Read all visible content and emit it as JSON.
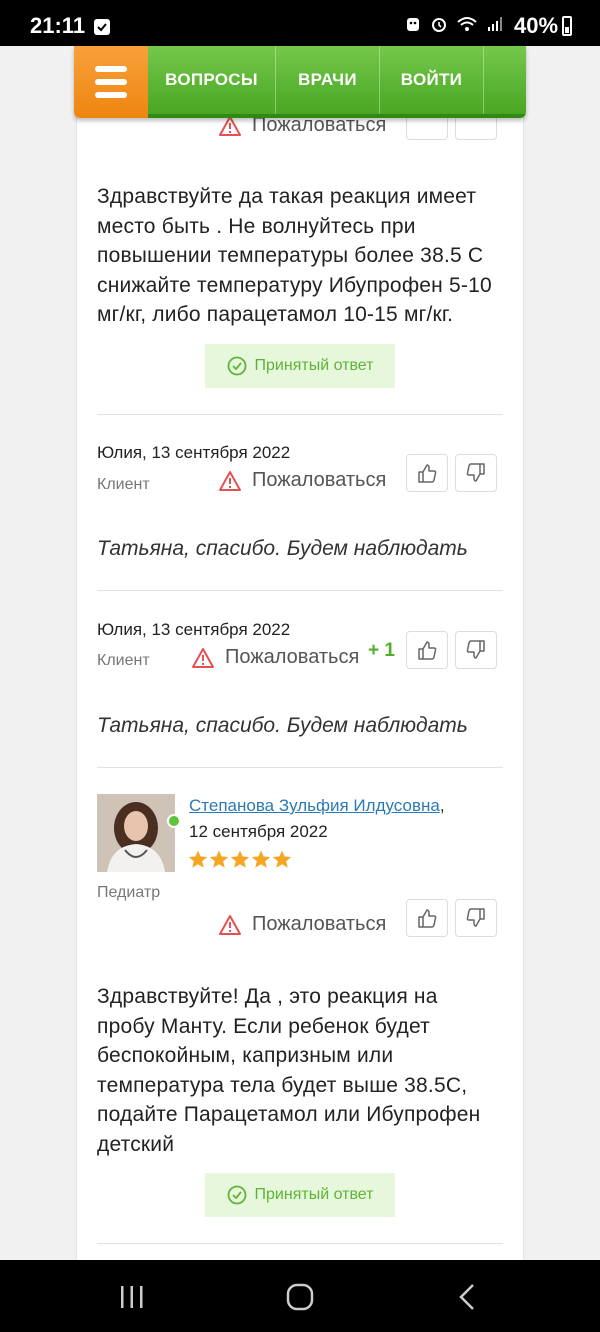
{
  "status_bar": {
    "time": "21:11",
    "battery": "40%"
  },
  "nav": {
    "questions": "ВОПРОСЫ",
    "doctors": "ВРАЧИ",
    "login": "ВОЙТИ"
  },
  "complain_label": "Пожаловаться",
  "accepted_label": "Принятый ответ",
  "answers": [
    {
      "text_lines": [
        "Здравствуйте да такая реакция имеет",
        "место быть . Не волнуйтесь при",
        "повышении температуры более 38.5 С",
        "снижайте температуру Ибупрофен 5-10",
        "мг/кг, либо парацетамол 10-15 мг/кг."
      ]
    },
    {
      "author": "Юлия, 13 сентября 2022",
      "role": "Клиент",
      "text": "Татьяна, спасибо. Будем наблюдать"
    },
    {
      "author": "Юлия, 13 сентября 2022",
      "role": "Клиент",
      "votes": "+ 1",
      "text": "Татьяна, спасибо. Будем наблюдать"
    },
    {
      "doctor_name": "Степанова Зульфия Илдусовна",
      "comma": ",",
      "date": "12 сентября 2022",
      "rating": 5,
      "role": "Педиатр",
      "text_lines": [
        "Здравствуйте! Да , это реакция на",
        "пробу Манту. Если ребенок будет",
        "беспокойным, капризным или",
        "температура тела будет выше 38.5С,",
        "подайте Парацетамол или Ибупрофен",
        "детский"
      ]
    }
  ],
  "colors": {
    "accent_green": "#52ad2c",
    "menu_orange": "#ef8510",
    "link_blue": "#2a7bb5"
  }
}
